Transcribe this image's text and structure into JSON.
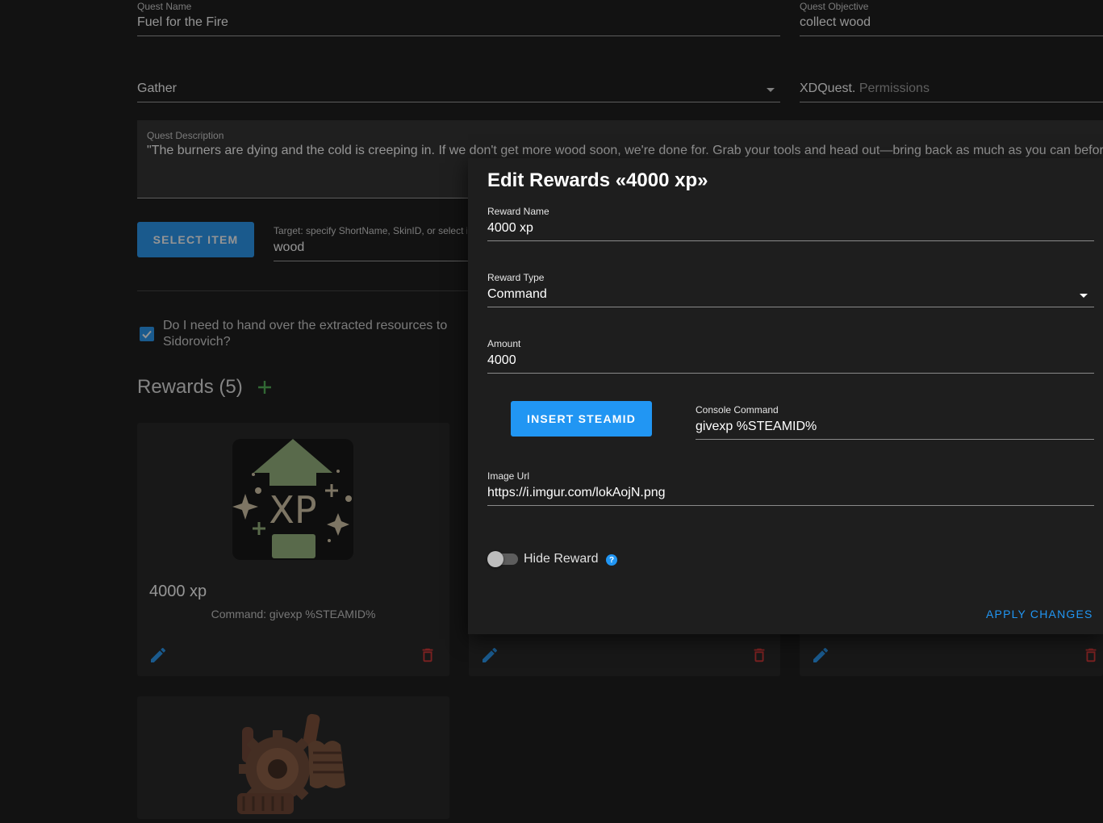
{
  "form": {
    "quest_name": {
      "label": "Quest Name",
      "value": "Fuel for the Fire"
    },
    "quest_objective": {
      "label": "Quest Objective",
      "value": "collect wood"
    },
    "quest_type": {
      "value": "Gather"
    },
    "permissions": {
      "prefix": "XDQuest.",
      "placeholder": "Permissions"
    },
    "description": {
      "label": "Quest Description",
      "value": "\"The burners are dying and the cold is creeping in. If we don't get more wood soon, we're done for. Grab your tools and head out—bring back as much as you can before"
    },
    "select_item_label": "SELECT ITEM",
    "target": {
      "label": "Target: specify ShortName, SkinID, or select i",
      "value": "wood"
    },
    "handover": {
      "checked": true,
      "line1": "Do I need to hand over the extracted resources to",
      "line2": "Sidorovich?"
    }
  },
  "rewards": {
    "title": "Rewards (5)",
    "add_icon": "plus-icon",
    "cards": [
      {
        "name": "4000 xp",
        "subtitle": "Command: givexp %STEAMID%",
        "image": "xp-icon"
      },
      {
        "name": "",
        "subtitle": "",
        "image": ""
      },
      {
        "name": "",
        "subtitle": "",
        "image": ""
      },
      {
        "name": "",
        "subtitle": "",
        "image": "gears-scrap-icon"
      }
    ]
  },
  "dialog": {
    "title": "Edit Rewards «4000 xp»",
    "reward_name": {
      "label": "Reward Name",
      "value": "4000 xp"
    },
    "reward_type": {
      "label": "Reward Type",
      "value": "Command"
    },
    "amount": {
      "label": "Amount",
      "value": "4000"
    },
    "insert_steamid_label": "INSERT STEAMID",
    "console_command": {
      "label": "Console Command",
      "value": "givexp %STEAMID%"
    },
    "image_url": {
      "label": "Image Url",
      "value": "https://i.imgur.com/lokAojN.png"
    },
    "hide_reward": {
      "label": "Hide Reward",
      "enabled": false,
      "help": "?"
    },
    "apply_label": "APPLY CHANGES"
  },
  "colors": {
    "accent": "#2196f3",
    "danger": "#d32f2f",
    "add": "#4caf50",
    "background": "#121212",
    "surface": "#1e1e1e"
  }
}
